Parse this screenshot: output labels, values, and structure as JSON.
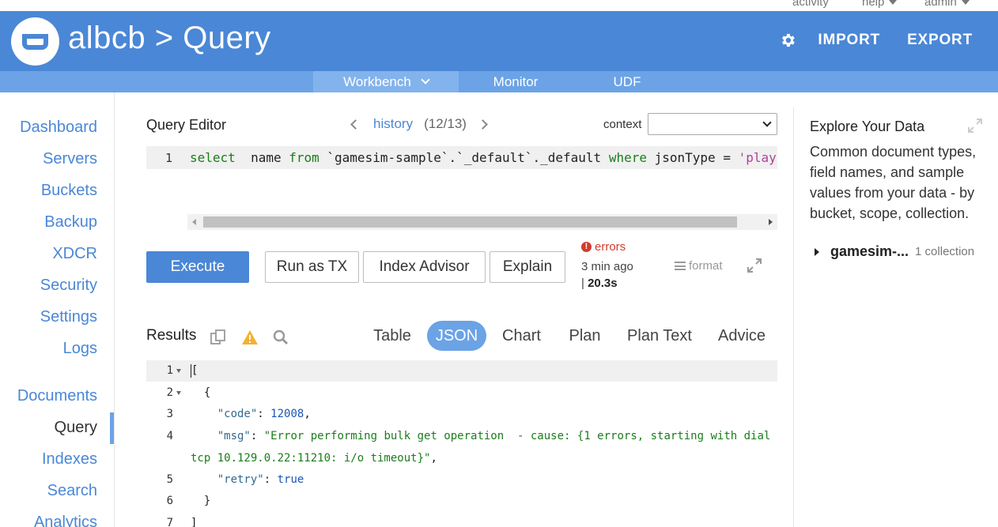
{
  "topbar": {
    "activity": "activity",
    "help": "help",
    "admin": "admin"
  },
  "header": {
    "title": "albcb > Query",
    "import": "IMPORT",
    "export": "EXPORT"
  },
  "subnav": {
    "tabs": [
      {
        "label": "Workbench"
      },
      {
        "label": "Monitor"
      },
      {
        "label": "UDF"
      }
    ]
  },
  "sidebar": {
    "items": [
      {
        "label": "Dashboard"
      },
      {
        "label": "Servers"
      },
      {
        "label": "Buckets"
      },
      {
        "label": "Backup"
      },
      {
        "label": "XDCR"
      },
      {
        "label": "Security"
      },
      {
        "label": "Settings"
      },
      {
        "label": "Logs"
      },
      {
        "label": "Documents"
      },
      {
        "label": "Query"
      },
      {
        "label": "Indexes"
      },
      {
        "label": "Search"
      },
      {
        "label": "Analytics"
      }
    ]
  },
  "query_editor": {
    "title": "Query Editor",
    "history_link": "history",
    "history_count": "(12/13)",
    "context_label": "context",
    "context_value": "",
    "line_number": "1",
    "query_parts": {
      "kw_select": "select",
      "t1": "  name ",
      "kw_from": "from",
      "t2": " `gamesim-sample`.`_default`._default ",
      "kw_where": "where",
      "t3": " jsonType = ",
      "str": "'play"
    }
  },
  "actions": {
    "execute": "Execute",
    "run_as_tx": "Run as TX",
    "index_advisor": "Index Advisor",
    "explain": "Explain",
    "errors": "errors",
    "time_ago": "3 min ago",
    "duration_sep": "|",
    "duration": "20.3s",
    "format": "format"
  },
  "results": {
    "title": "Results",
    "tabs": [
      {
        "label": "Table"
      },
      {
        "label": "JSON"
      },
      {
        "label": "Chart"
      },
      {
        "label": "Plan"
      },
      {
        "label": "Plan Text"
      },
      {
        "label": "Advice"
      }
    ],
    "json_lines": [
      {
        "num": "1",
        "text": "["
      },
      {
        "num": "2",
        "text": "  {"
      },
      {
        "num": "3",
        "key": "\"code\"",
        "value": "12008",
        "tail": ","
      },
      {
        "num": "4",
        "key": "\"msg\"",
        "value": "\"Error performing bulk get operation  - cause: {1 errors, starting with dial"
      },
      {
        "num": "",
        "value": "tcp 10.129.0.22:11210: i/o timeout}\"",
        "tail": ","
      },
      {
        "num": "5",
        "key": "\"retry\"",
        "value": "true"
      },
      {
        "num": "6",
        "text": "  }"
      },
      {
        "num": "7",
        "text": "]"
      }
    ]
  },
  "explore": {
    "title": "Explore Your Data",
    "description": "Common document types, field names, and sample values from your data - by bucket, scope, collection.",
    "bucket": "gamesim-...",
    "collections": "1 collection"
  }
}
